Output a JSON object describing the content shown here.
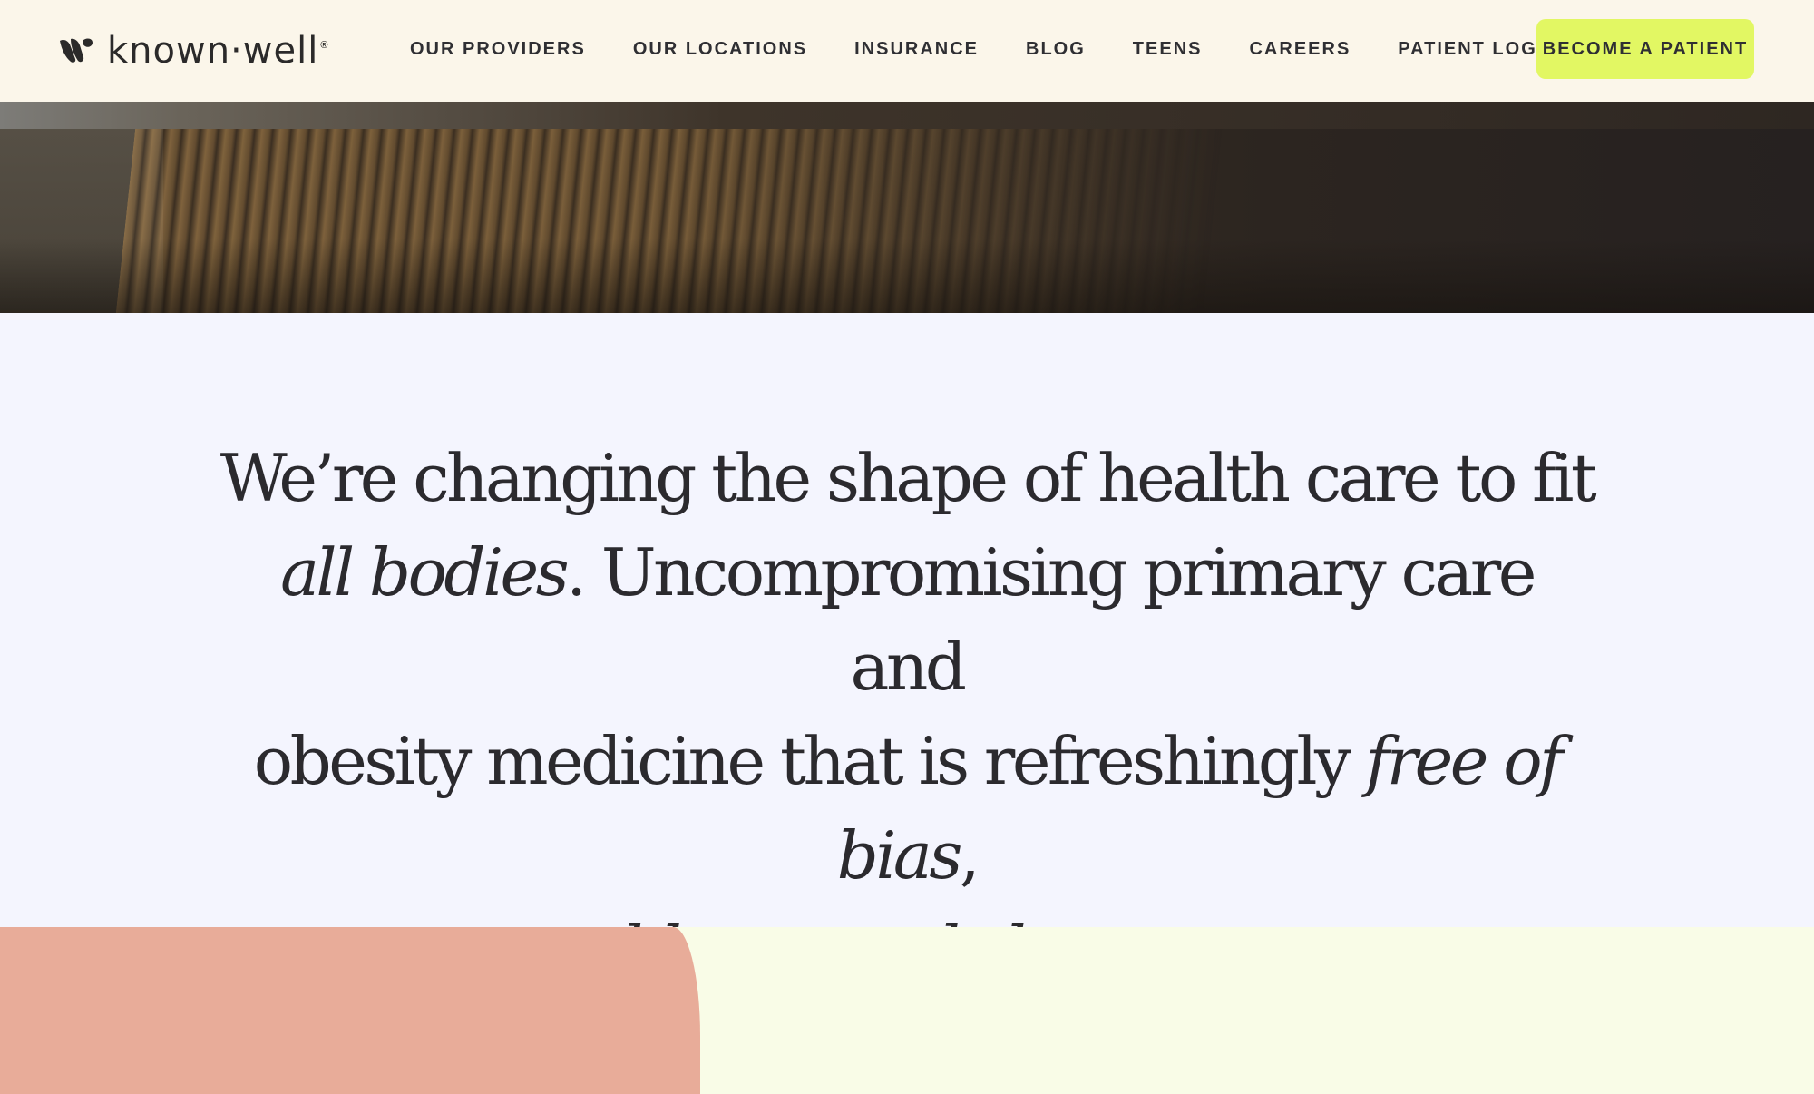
{
  "brand": {
    "name": "known·well",
    "registered": "®",
    "logo_icon": "known-well-mark"
  },
  "nav": {
    "items": [
      {
        "label": "OUR PROVIDERS"
      },
      {
        "label": "OUR LOCATIONS"
      },
      {
        "label": "INSURANCE"
      },
      {
        "label": "BLOG"
      },
      {
        "label": "TEENS"
      },
      {
        "label": "CAREERS"
      },
      {
        "label": "PATIENT LOGIN"
      }
    ],
    "cta_label": "BECOME A PATIENT"
  },
  "mission": {
    "line1": "We’re changing the shape of health care to fit",
    "line2_em": "all bodies",
    "line2_rest": ". Uncompromising primary care and",
    "line3_plain": "obesity medicine that is refreshingly ",
    "line3_em": "free of bias",
    "line3_end": ",",
    "line4_em": "blame, and shame",
    "line4_end": "."
  },
  "colors": {
    "header_bg": "#fbf6ea",
    "cta_bg": "#e2f763",
    "mission_bg": "#f4f5fe",
    "text": "#2b2a2e",
    "blob": "#e8ac99",
    "bottom_bg": "#f9fce7"
  }
}
